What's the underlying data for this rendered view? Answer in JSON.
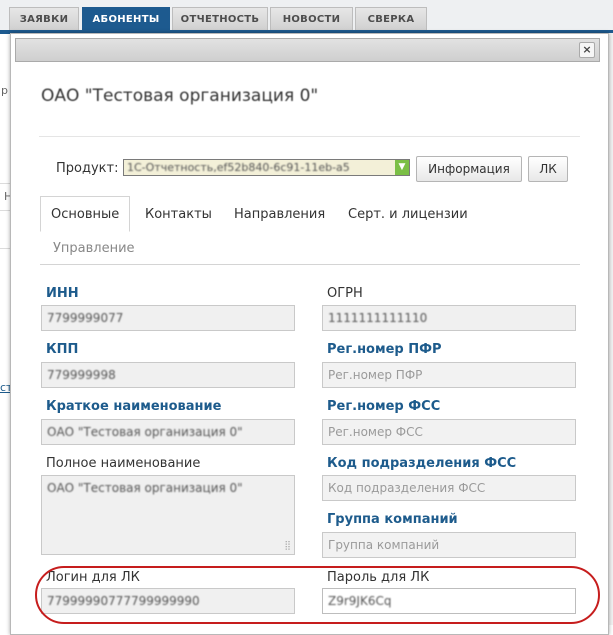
{
  "topnav": {
    "tabs": [
      {
        "label": "ЗАЯВКИ",
        "active": false
      },
      {
        "label": "АБОНЕНТЫ",
        "active": true
      },
      {
        "label": "ОТЧЕТНОСТЬ",
        "active": false
      },
      {
        "label": "НОВОСТИ",
        "active": false
      },
      {
        "label": "СВЕРКА",
        "active": false
      }
    ],
    "accent_color": "#1d5a8f"
  },
  "background": {
    "fragment_1": "р",
    "fragment_2": "Н",
    "fragment_3": "ст"
  },
  "modal": {
    "close_label": "×",
    "org_title": "ОАО \"Тестовая организация 0\"",
    "product": {
      "label": "Продукт:",
      "value": "1С-Отчетность,ef52b840-6c91-11eb-a5",
      "info_button": "Информация",
      "lk_button": "ЛК"
    },
    "tabs": [
      {
        "label": "Основные",
        "active": true
      },
      {
        "label": "Контакты",
        "active": false
      },
      {
        "label": "Направления",
        "active": false
      },
      {
        "label": "Серт. и лицензии",
        "active": false
      },
      {
        "label": "Управление",
        "active": false,
        "muted": true
      }
    ],
    "fields": {
      "inn": {
        "label": "ИНН",
        "value": "7799999077"
      },
      "ogrn": {
        "label": "ОГРН",
        "value": "1111111111110"
      },
      "kpp": {
        "label": "КПП",
        "value": "779999998"
      },
      "reg_pfr": {
        "label": "Рег.номер ПФР",
        "placeholder": "Рег.номер ПФР"
      },
      "short_name": {
        "label": "Краткое наименование",
        "value": "ОАО \"Тестовая организация 0\""
      },
      "reg_fss": {
        "label": "Рег.номер ФСС",
        "placeholder": "Рег.номер ФСС"
      },
      "full_name": {
        "label": "Полное наименование",
        "value": "ОАО \"Тестовая организация 0\""
      },
      "fss_code": {
        "label": "Код подразделения ФСС",
        "placeholder": "Код подразделения ФСС"
      },
      "company_group": {
        "label": "Группа компаний",
        "placeholder": "Группа компаний"
      },
      "lk_login": {
        "label": "Логин для ЛК",
        "value": "77999990777799999990"
      },
      "lk_password": {
        "label": "Пароль для ЛК",
        "value": "Z9r9JK6Cq"
      }
    },
    "highlight_color": "#c61d1d"
  }
}
